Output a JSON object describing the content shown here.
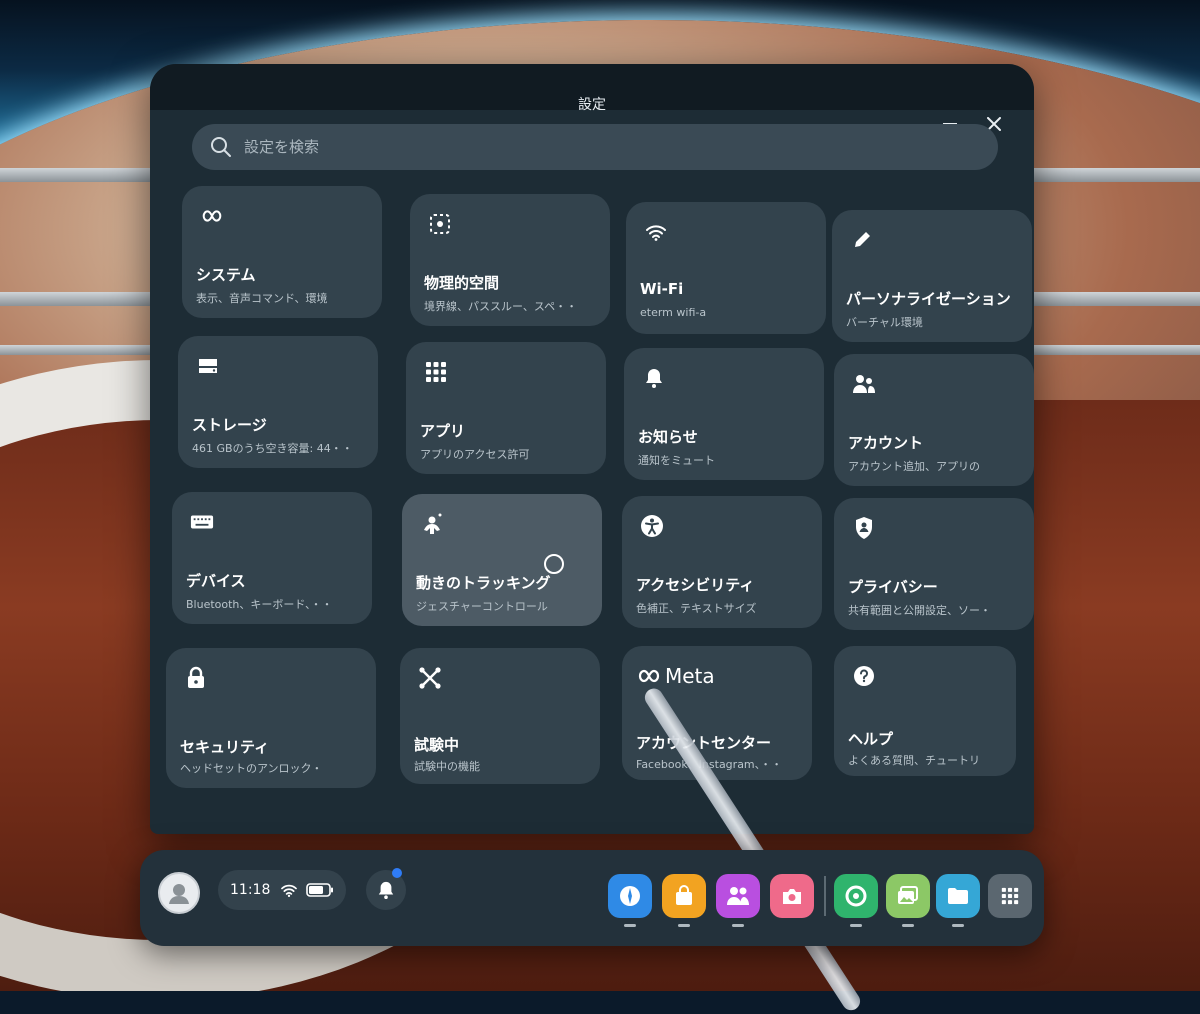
{
  "window": {
    "title": "設定",
    "search_placeholder": "設定を検索"
  },
  "tiles": [
    {
      "id": "system",
      "label": "システム",
      "sub": "表示、音声コマンド、環境",
      "icon": "meta-infinity-icon"
    },
    {
      "id": "physical-space",
      "label": "物理的空間",
      "sub": "境界線、パススルー、スペ・・",
      "icon": "boundary-icon"
    },
    {
      "id": "wifi",
      "label": "Wi-Fi",
      "sub": "eterm wifi-a",
      "icon": "wifi-icon"
    },
    {
      "id": "personalization",
      "label": "パーソナライゼーション",
      "sub": "バーチャル環境",
      "icon": "pencil-icon"
    },
    {
      "id": "storage",
      "label": "ストレージ",
      "sub": "461 GBのうち空き容量: 44・・",
      "icon": "storage-icon"
    },
    {
      "id": "apps",
      "label": "アプリ",
      "sub": "アプリのアクセス許可",
      "icon": "grid-icon"
    },
    {
      "id": "notifications",
      "label": "お知らせ",
      "sub": "通知をミュート",
      "icon": "bell-icon"
    },
    {
      "id": "account",
      "label": "アカウント",
      "sub": "アカウント追加、アプリの",
      "icon": "people-icon"
    },
    {
      "id": "devices",
      "label": "デバイス",
      "sub": "Bluetooth、キーボード、・・",
      "icon": "keyboard-icon"
    },
    {
      "id": "movement-tracking",
      "label": "動きのトラッキング",
      "sub": "ジェスチャーコントロール",
      "icon": "hand-tracking-icon"
    },
    {
      "id": "accessibility",
      "label": "アクセシビリティ",
      "sub": "色補正、テキストサイズ",
      "icon": "accessibility-icon"
    },
    {
      "id": "privacy",
      "label": "プライバシー",
      "sub": "共有範囲と公開設定、ソー・",
      "icon": "shield-icon"
    },
    {
      "id": "security",
      "label": "セキュリティ",
      "sub": "ヘッドセットのアンロック・",
      "icon": "lock-icon"
    },
    {
      "id": "experimental",
      "label": "試験中",
      "sub": "試験中の機能",
      "icon": "experiment-icon"
    },
    {
      "id": "accounts-center",
      "label": "アカウントセンター",
      "sub": "Facebook、Instagram、・・",
      "icon": "meta-logo-icon",
      "logo_text": "Meta"
    },
    {
      "id": "help",
      "label": "ヘルプ",
      "sub": "よくある質問、チュートリ",
      "icon": "help-icon"
    }
  ],
  "taskbar": {
    "time": "11:18",
    "apps": [
      {
        "name": "explore-app",
        "color": "#2f8ae6"
      },
      {
        "name": "store-app",
        "color": "#f2a321"
      },
      {
        "name": "people-app",
        "color": "#b94fe0"
      },
      {
        "name": "camera-app",
        "color": "#ef6a8a"
      },
      {
        "name": "quest-app",
        "color": "#2fb46d"
      },
      {
        "name": "gallery-app",
        "color": "#8cc866"
      },
      {
        "name": "files-app",
        "color": "#35a7d6"
      },
      {
        "name": "library-app",
        "color": "#5b6770"
      }
    ]
  }
}
